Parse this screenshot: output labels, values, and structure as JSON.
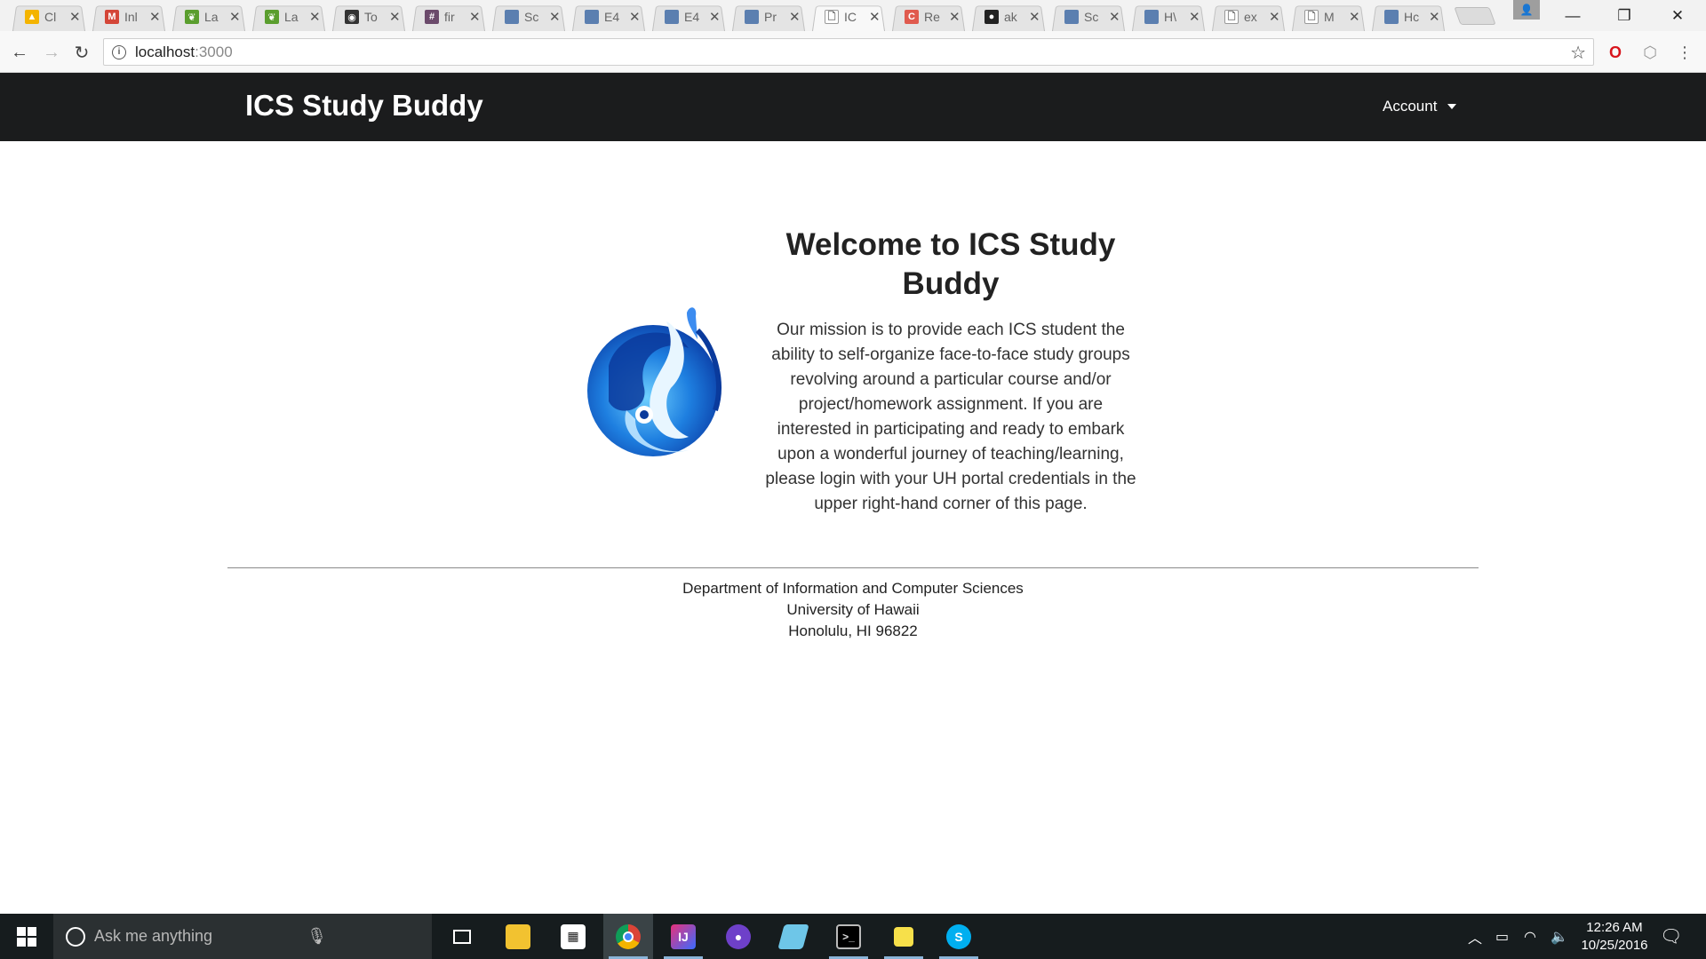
{
  "browser": {
    "tabs": [
      {
        "title": "Cl",
        "icon": "google-drive-icon",
        "color": "#f4b400",
        "glyph": "▲"
      },
      {
        "title": "Inl",
        "icon": "gmail-icon",
        "color": "#d44638",
        "glyph": "M"
      },
      {
        "title": "La",
        "icon": "leaf-icon",
        "color": "#5a9e2e",
        "glyph": "❦"
      },
      {
        "title": "La",
        "icon": "leaf-icon",
        "color": "#5a9e2e",
        "glyph": "❦"
      },
      {
        "title": "To",
        "icon": "chat-icon",
        "color": "#333333",
        "glyph": "◉"
      },
      {
        "title": "fir",
        "icon": "hash-icon",
        "color": "#6b4a6b",
        "glyph": "#"
      },
      {
        "title": "Sc",
        "icon": "page-icon",
        "color": "#5b7fb0",
        "glyph": ""
      },
      {
        "title": "E4",
        "icon": "page-icon",
        "color": "#5b7fb0",
        "glyph": ""
      },
      {
        "title": "E4",
        "icon": "page-icon",
        "color": "#5b7fb0",
        "glyph": ""
      },
      {
        "title": "Pr",
        "icon": "page-icon",
        "color": "#5b7fb0",
        "glyph": ""
      },
      {
        "title": "IC",
        "icon": "document-icon",
        "color": "#ffffff",
        "glyph": "🗋",
        "active": true
      },
      {
        "title": "Re",
        "icon": "c-icon",
        "color": "#e05a4e",
        "glyph": "C"
      },
      {
        "title": "ak",
        "icon": "github-icon",
        "color": "#222222",
        "glyph": "●"
      },
      {
        "title": "Sc",
        "icon": "page-icon",
        "color": "#5b7fb0",
        "glyph": ""
      },
      {
        "title": "H\\",
        "icon": "page-icon",
        "color": "#5b7fb0",
        "glyph": ""
      },
      {
        "title": "ex",
        "icon": "document-icon",
        "color": "#ffffff",
        "glyph": "🗋"
      },
      {
        "title": "M",
        "icon": "document-icon",
        "color": "#ffffff",
        "glyph": "🗋"
      },
      {
        "title": "Hc",
        "icon": "page-icon",
        "color": "#5b7fb0",
        "glyph": ""
      }
    ],
    "url_host": "localhost",
    "url_port": ":3000"
  },
  "app": {
    "brand": "ICS Study Buddy",
    "account_label": "Account",
    "welcome_title": "Welcome to ICS Study Buddy",
    "mission": "Our mission is to provide each ICS student the ability to self-organize face-to-face study groups revolving around a particular course and/or project/homework assignment. If you are interested in participating and ready to embark upon a wonderful journey of teaching/learning, please login with your UH portal credentials in the upper right-hand corner of this page.",
    "footer": {
      "line1": "Department of Information and Computer Sciences",
      "line2": "University of Hawaii",
      "line3": "Honolulu, HI 96822"
    }
  },
  "taskbar": {
    "search_placeholder": "Ask me anything",
    "time": "12:26 AM",
    "date": "10/25/2016"
  },
  "colors": {
    "navbar": "#1b1c1d",
    "taskbar": "#161c1e"
  }
}
